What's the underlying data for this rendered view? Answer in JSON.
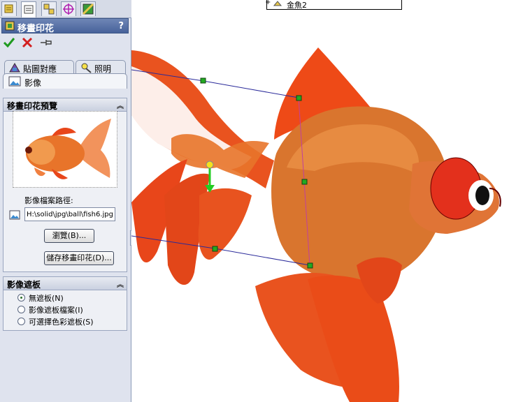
{
  "property_manager": {
    "title": "移畫印花",
    "help": "?",
    "tabs": [
      {
        "label": "貼圖對應",
        "icon": "mapping-icon"
      },
      {
        "label": "照明",
        "icon": "lighting-icon"
      }
    ],
    "image_tab_label": "影像"
  },
  "preview_group": {
    "header": "移畫印花預覽",
    "path_label": "影像檔案路徑:",
    "path_value": "H:\\solid\\jpg\\ball\\fish6.jpg",
    "browse_label": "瀏覽(B)...",
    "save_label": "儲存移畫印花(D)..."
  },
  "mask_group": {
    "header": "影像遮板",
    "options": [
      {
        "label": "無遮板(N)",
        "selected": true
      },
      {
        "label": "影像遮板檔案(I)",
        "selected": false
      },
      {
        "label": "可選擇色彩遮板(S)",
        "selected": false
      }
    ]
  },
  "tree_item": "金魚2",
  "colors": {
    "fish_orange": "#e8461a",
    "fish_body": "#d9752e",
    "handle_green": "#22aa22",
    "frame_line": "#2a2a9a",
    "accent_title": "#4d6aa0"
  }
}
